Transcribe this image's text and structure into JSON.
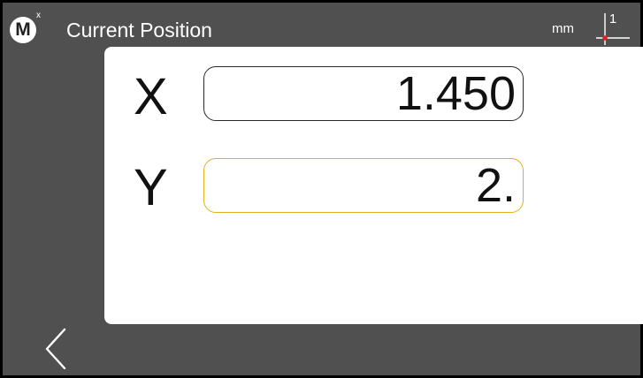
{
  "header": {
    "logo_letter": "M",
    "logo_superscript": "x",
    "title": "Current Position",
    "unit": "mm",
    "datum_number": "1"
  },
  "axes": {
    "x": {
      "label": "X",
      "value": "1.450",
      "active": false
    },
    "y": {
      "label": "Y",
      "value": "2.",
      "active": true
    }
  },
  "icons": {
    "logo": "m-logo-icon",
    "datum": "datum-origin-icon",
    "back": "chevron-left-icon"
  },
  "colors": {
    "background": "#505050",
    "panel": "#ffffff",
    "active_field_border": "#e0b020",
    "field_border": "#2a2a2a",
    "datum_marker": "#e02020"
  }
}
